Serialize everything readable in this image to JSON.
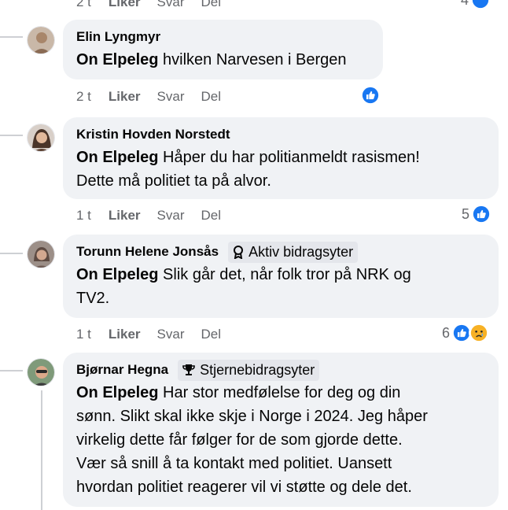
{
  "top_partial": {
    "time": "2 t",
    "like": "Liker",
    "reply": "Svar",
    "delete": "Del",
    "count": "4"
  },
  "comments": [
    {
      "author": "Elin Lyngmyr",
      "tag": "On Elpeleg",
      "lines": [
        "hvilken Narvesen i Bergen"
      ],
      "time": "2 t",
      "like": "Liker",
      "reply": "Svar",
      "delete": "Del",
      "count": ""
    },
    {
      "author": "Kristin Hovden Norstedt",
      "tag": "On Elpeleg",
      "lines": [
        "Håper du har politianmeldt rasismen!",
        "Dette må politiet ta på alvor."
      ],
      "time": "1 t",
      "like": "Liker",
      "reply": "Svar",
      "delete": "Del",
      "count": "5"
    },
    {
      "author": "Torunn Helene Jonsås",
      "badge": "Aktiv bidragsyter",
      "tag": "On Elpeleg",
      "lines": [
        "Slik går det, når folk tror på NRK og",
        "TV2."
      ],
      "time": "1 t",
      "like": "Liker",
      "reply": "Svar",
      "delete": "Del",
      "count": "6"
    },
    {
      "author": "Bjørnar Hegna",
      "badge": "Stjernebidragsyter",
      "tag": "On Elpeleg",
      "lines": [
        "Har stor medfølelse for deg og din",
        "sønn. Slikt skal ikke skje i Norge i 2024. Jeg håper",
        "virkelig dette får følger for de som gjorde dette.",
        "Vær så snill å ta kontakt med politiet. Uansett",
        "hvordan politiet reagerer vil vi støtte og dele det."
      ]
    }
  ],
  "colors": {
    "bubble": "#f0f2f5",
    "like_blue": "#1877f2",
    "secondary_text": "#65676b",
    "line": "#ced0d4"
  }
}
